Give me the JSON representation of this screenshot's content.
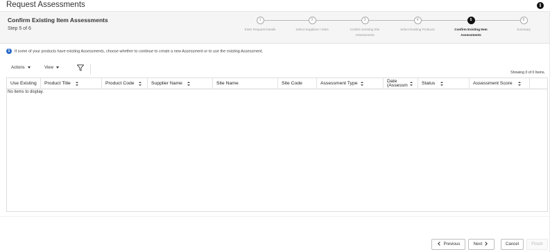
{
  "app": {
    "title": "Request Assessments"
  },
  "header": {
    "title": "Confirm Existing Item Assessments",
    "step_text": "Step 5 of 6"
  },
  "train": [
    {
      "num": "1",
      "label": "Enter Request Details",
      "active": false
    },
    {
      "num": "2",
      "label": "Select Suppliers / Sites",
      "active": false
    },
    {
      "num": "3",
      "label": "Confirm Existing Site Assessments",
      "active": false
    },
    {
      "num": "4",
      "label": "Select Existing Products",
      "active": false
    },
    {
      "num": "5",
      "label": "Confirm Existing Item Assessments",
      "active": true
    },
    {
      "num": "6",
      "label": "Summary",
      "active": false
    }
  ],
  "info_message": "If some of your products have existing Assessments, choose whether to continue to create a new Assessment or to use the existing Assessment.",
  "toolbar": {
    "actions_label": "Actions",
    "view_label": "View",
    "filter_icon": "filter-icon"
  },
  "showing_text": "Showing 0 of 0 Items.",
  "table": {
    "columns": [
      {
        "label": "Use Existing",
        "sortable": false
      },
      {
        "label": "Product Title",
        "sortable": true
      },
      {
        "label": "Product Code",
        "sortable": true
      },
      {
        "label": "Supplier Name",
        "sortable": true
      },
      {
        "label": "Site Name",
        "sortable": false
      },
      {
        "label": "Site Code",
        "sortable": false
      },
      {
        "label": "Assessment Type",
        "sortable": true
      },
      {
        "label": "Date (Assessm",
        "sortable": true
      },
      {
        "label": "Status",
        "sortable": true
      },
      {
        "label": "Assessment Score",
        "sortable": true
      }
    ],
    "empty_text": "No items to display."
  },
  "footer": {
    "previous_label": "Previous",
    "next_label": "Next",
    "cancel_label": "Cancel",
    "finish_label": "Finish"
  }
}
